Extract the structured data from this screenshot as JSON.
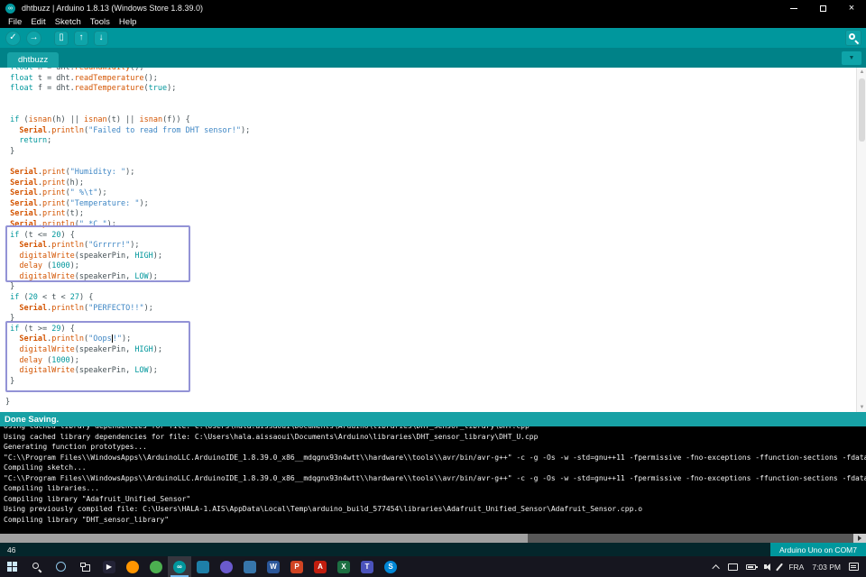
{
  "colors": {
    "toolbar_teal": "#00979D",
    "tab_strip_teal": "#008288",
    "active_tab_teal": "#17A1A5",
    "status_bar_teal": "#17A1A5",
    "console_bg": "#000000",
    "annotation_box": "#9393D6",
    "keyword": "#00979C",
    "function": "#D35400",
    "string": "#3F87C5"
  },
  "window": {
    "title": "dhtbuzz | Arduino 1.8.13 (Windows Store 1.8.39.0)",
    "close_glyph": "×"
  },
  "menu": {
    "items": [
      "File",
      "Edit",
      "Sketch",
      "Tools",
      "Help"
    ]
  },
  "toolbar": {
    "buttons": [
      {
        "name": "verify",
        "glyph": "✓",
        "shape": "circle"
      },
      {
        "name": "upload",
        "glyph": "→",
        "shape": "circle"
      },
      {
        "name": "new-sketch",
        "glyph": "▯",
        "shape": "square",
        "gap": true
      },
      {
        "name": "open",
        "glyph": "↑",
        "shape": "square"
      },
      {
        "name": "save",
        "glyph": "↓",
        "shape": "square"
      }
    ]
  },
  "tabs": {
    "active_label": "dhtbuzz",
    "menu_glyph": "▼"
  },
  "editor": {
    "lines": [
      [
        [
          "p",
          " "
        ],
        [
          "k",
          "float"
        ],
        [
          "p",
          " h = dht."
        ],
        [
          "f",
          "readHumidity"
        ],
        [
          "p",
          "();"
        ]
      ],
      [
        [
          "p",
          " "
        ],
        [
          "k",
          "float"
        ],
        [
          "p",
          " t = dht."
        ],
        [
          "f",
          "readTemperature"
        ],
        [
          "p",
          "();"
        ]
      ],
      [
        [
          "p",
          " "
        ],
        [
          "k",
          "float"
        ],
        [
          "p",
          " f = dht."
        ],
        [
          "f",
          "readTemperature"
        ],
        [
          "p",
          "("
        ],
        [
          "k",
          "true"
        ],
        [
          "p",
          ");"
        ]
      ],
      [],
      [],
      [
        [
          "p",
          " "
        ],
        [
          "k",
          "if"
        ],
        [
          "p",
          " ("
        ],
        [
          "f",
          "isnan"
        ],
        [
          "p",
          "(h) || "
        ],
        [
          "f",
          "isnan"
        ],
        [
          "p",
          "(t) || "
        ],
        [
          "f",
          "isnan"
        ],
        [
          "p",
          "(f)) {"
        ]
      ],
      [
        [
          "p",
          "   "
        ],
        [
          "b",
          "Serial"
        ],
        [
          "p",
          "."
        ],
        [
          "f",
          "println"
        ],
        [
          "p",
          "("
        ],
        [
          "s",
          "\"Failed to read from DHT sensor!\""
        ],
        [
          "p",
          ");"
        ]
      ],
      [
        [
          "p",
          "   "
        ],
        [
          "k",
          "return"
        ],
        [
          "p",
          ";"
        ]
      ],
      [
        [
          "p",
          " }"
        ]
      ],
      [],
      [
        [
          "p",
          " "
        ],
        [
          "b",
          "Serial"
        ],
        [
          "p",
          "."
        ],
        [
          "f",
          "print"
        ],
        [
          "p",
          "("
        ],
        [
          "s",
          "\"Humidity: \""
        ],
        [
          "p",
          ");"
        ]
      ],
      [
        [
          "p",
          " "
        ],
        [
          "b",
          "Serial"
        ],
        [
          "p",
          "."
        ],
        [
          "f",
          "print"
        ],
        [
          "p",
          "(h);"
        ]
      ],
      [
        [
          "p",
          " "
        ],
        [
          "b",
          "Serial"
        ],
        [
          "p",
          "."
        ],
        [
          "f",
          "print"
        ],
        [
          "p",
          "("
        ],
        [
          "s",
          "\" %\\t\""
        ],
        [
          "p",
          ");"
        ]
      ],
      [
        [
          "p",
          " "
        ],
        [
          "b",
          "Serial"
        ],
        [
          "p",
          "."
        ],
        [
          "f",
          "print"
        ],
        [
          "p",
          "("
        ],
        [
          "s",
          "\"Temperature: \""
        ],
        [
          "p",
          ");"
        ]
      ],
      [
        [
          "p",
          " "
        ],
        [
          "b",
          "Serial"
        ],
        [
          "p",
          "."
        ],
        [
          "f",
          "print"
        ],
        [
          "p",
          "(t);"
        ]
      ],
      [
        [
          "p",
          " "
        ],
        [
          "b",
          "Serial"
        ],
        [
          "p",
          "."
        ],
        [
          "f",
          "println"
        ],
        [
          "p",
          "("
        ],
        [
          "s",
          "\" *C \""
        ],
        [
          "p",
          ");"
        ]
      ],
      [
        [
          "p",
          " "
        ],
        [
          "k",
          "if"
        ],
        [
          "p",
          " (t <= "
        ],
        [
          "n",
          "20"
        ],
        [
          "p",
          ") {"
        ]
      ],
      [
        [
          "p",
          "   "
        ],
        [
          "b",
          "Serial"
        ],
        [
          "p",
          "."
        ],
        [
          "f",
          "println"
        ],
        [
          "p",
          "("
        ],
        [
          "s",
          "\"Grrrrr!\""
        ],
        [
          "p",
          ");"
        ]
      ],
      [
        [
          "p",
          "   "
        ],
        [
          "f",
          "digitalWrite"
        ],
        [
          "p",
          "(speakerPin, "
        ],
        [
          "k",
          "HIGH"
        ],
        [
          "p",
          ");"
        ]
      ],
      [
        [
          "p",
          "   "
        ],
        [
          "f",
          "delay"
        ],
        [
          "p",
          " ("
        ],
        [
          "n",
          "1000"
        ],
        [
          "p",
          ");"
        ]
      ],
      [
        [
          "p",
          "   "
        ],
        [
          "f",
          "digitalWrite"
        ],
        [
          "p",
          "(speakerPin, "
        ],
        [
          "k",
          "LOW"
        ],
        [
          "p",
          ");"
        ]
      ],
      [
        [
          "p",
          " }"
        ]
      ],
      [
        [
          "p",
          " "
        ],
        [
          "k",
          "if"
        ],
        [
          "p",
          " ("
        ],
        [
          "n",
          "20"
        ],
        [
          "p",
          " < t < "
        ],
        [
          "n",
          "27"
        ],
        [
          "p",
          ") {"
        ]
      ],
      [
        [
          "p",
          "   "
        ],
        [
          "b",
          "Serial"
        ],
        [
          "p",
          "."
        ],
        [
          "f",
          "println"
        ],
        [
          "p",
          "("
        ],
        [
          "s",
          "\"PERFECTO!!\""
        ],
        [
          "p",
          ");"
        ]
      ],
      [
        [
          "p",
          " }"
        ]
      ],
      [
        [
          "p",
          " "
        ],
        [
          "k",
          "if"
        ],
        [
          "p",
          " (t >= "
        ],
        [
          "n",
          "29"
        ],
        [
          "p",
          ") {"
        ]
      ],
      [
        [
          "p",
          "   "
        ],
        [
          "b",
          "Serial"
        ],
        [
          "p",
          "."
        ],
        [
          "f",
          "println"
        ],
        [
          "p",
          "("
        ],
        [
          "s",
          "\"Oops"
        ],
        [
          "caret",
          ""
        ],
        [
          "s",
          "!\""
        ],
        [
          "p",
          ");"
        ]
      ],
      [
        [
          "p",
          "   "
        ],
        [
          "f",
          "digitalWrite"
        ],
        [
          "p",
          "(speakerPin, "
        ],
        [
          "k",
          "HIGH"
        ],
        [
          "p",
          ");"
        ]
      ],
      [
        [
          "p",
          "   "
        ],
        [
          "f",
          "delay"
        ],
        [
          "p",
          " ("
        ],
        [
          "n",
          "1000"
        ],
        [
          "p",
          ");"
        ]
      ],
      [
        [
          "p",
          "   "
        ],
        [
          "f",
          "digitalWrite"
        ],
        [
          "p",
          "(speakerPin, "
        ],
        [
          "k",
          "LOW"
        ],
        [
          "p",
          ");"
        ]
      ],
      [
        [
          "p",
          " }"
        ]
      ],
      [],
      [
        [
          "p",
          "}"
        ]
      ]
    ]
  },
  "status_bar": {
    "message": "Done Saving."
  },
  "console": {
    "lines": [
      "Using cached library dependencies for file: C:\\Users\\hala.aissaoui\\Documents\\Arduino\\libraries\\DHT_sensor_library\\DHT.cpp",
      "Using cached library dependencies for file: C:\\Users\\hala.aissaoui\\Documents\\Arduino\\libraries\\DHT_sensor_library\\DHT_U.cpp",
      "Generating function prototypes...",
      "\"C:\\\\Program Files\\\\WindowsApps\\\\ArduinoLLC.ArduinoIDE_1.8.39.0_x86__mdqgnx93n4wtt\\\\hardware\\\\tools\\\\avr/bin/avr-g++\" -c -g -Os -w -std=gnu++11 -fpermissive -fno-exceptions -ffunction-sections -fdata-sections -fno-threadsafe-statics",
      "Compiling sketch...",
      "\"C:\\\\Program Files\\\\WindowsApps\\\\ArduinoLLC.ArduinoIDE_1.8.39.0_x86__mdqgnx93n4wtt\\\\hardware\\\\tools\\\\avr/bin/avr-g++\" -c -g -Os -w -std=gnu++11 -fpermissive -fno-exceptions -ffunction-sections -fdata-sections -fno-threadsafe-statics",
      "Compiling libraries...",
      "Compiling library \"Adafruit_Unified_Sensor\"",
      "Using previously compiled file: C:\\Users\\HALA-1.AIS\\AppData\\Local\\Temp\\arduino_build_577454\\libraries\\Adafruit_Unified_Sensor\\Adafruit_Sensor.cpp.o",
      "Compiling library \"DHT_sensor_library\""
    ]
  },
  "ide_footer": {
    "line_number": "46",
    "board_status": "Arduino Uno on COM7"
  },
  "taskbar": {
    "apps": [
      {
        "name": "media-player",
        "color": "#232336",
        "glyph": "▶",
        "shape": "rounded",
        "active": false
      },
      {
        "name": "firefox",
        "color": "#ff9500",
        "glyph": "",
        "shape": "circle",
        "active": false
      },
      {
        "name": "chrome",
        "color": "#4caf50",
        "glyph": "",
        "shape": "circle",
        "active": false
      },
      {
        "name": "arduino",
        "color": "#00979d",
        "glyph": "∞",
        "shape": "circle",
        "active": true
      },
      {
        "name": "ide",
        "color": "#1e7fa8",
        "glyph": "",
        "shape": "rounded",
        "active": false
      },
      {
        "name": "discord",
        "color": "#6a5acd",
        "glyph": "",
        "shape": "circle",
        "active": false
      },
      {
        "name": "python",
        "color": "#3776ab",
        "glyph": "",
        "shape": "rounded",
        "active": false
      },
      {
        "name": "word",
        "color": "#2b579a",
        "glyph": "W",
        "shape": "rounded",
        "active": false
      },
      {
        "name": "powerpoint",
        "color": "#d04423",
        "glyph": "P",
        "shape": "rounded",
        "active": false
      },
      {
        "name": "acrobat",
        "color": "#c11e0f",
        "glyph": "A",
        "shape": "rounded",
        "active": false
      },
      {
        "name": "excel",
        "color": "#1d6f42",
        "glyph": "X",
        "shape": "rounded",
        "active": false
      },
      {
        "name": "teams",
        "color": "#4b53bc",
        "glyph": "T",
        "shape": "rounded",
        "active": false
      },
      {
        "name": "skype",
        "color": "#0087d6",
        "glyph": "S",
        "shape": "circle",
        "active": false
      }
    ],
    "tray": {
      "language": "FRA",
      "time": "7:03 PM"
    }
  }
}
